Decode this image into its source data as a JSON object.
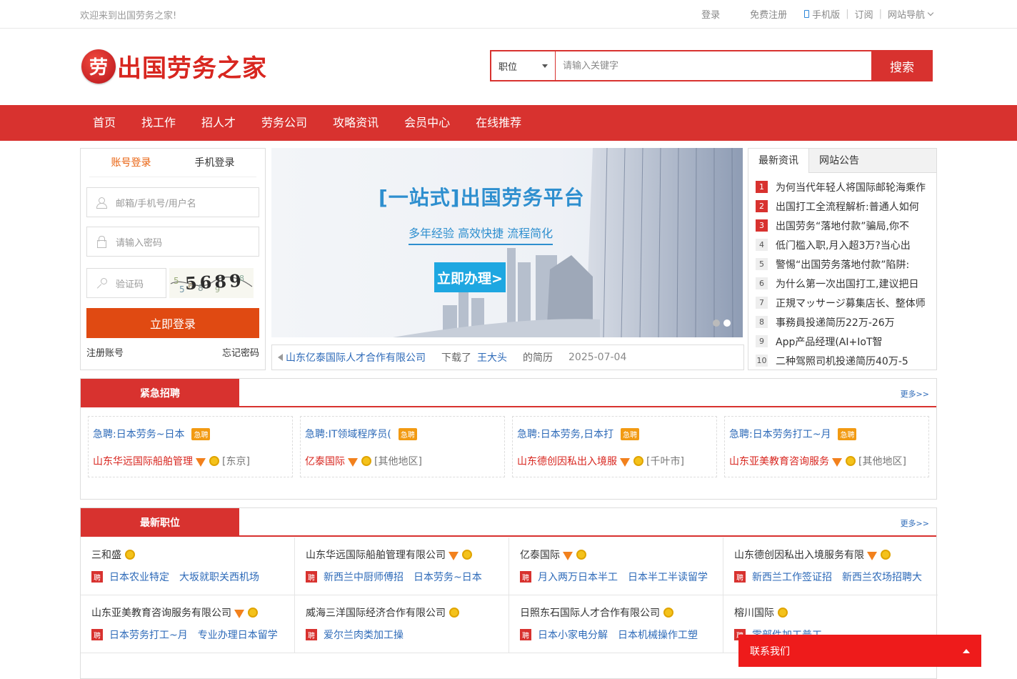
{
  "topbar": {
    "welcome": "欢迎来到出国劳务之家!",
    "login": "登录",
    "register": "免费注册",
    "mobile": "手机版",
    "subscribe": "订阅",
    "site_nav": "网站导航"
  },
  "header": {
    "logo_text": "出国劳务之家",
    "search": {
      "category": "职位",
      "placeholder": "请输入关键字",
      "button": "搜索"
    }
  },
  "nav": [
    "首页",
    "找工作",
    "招人才",
    "劳务公司",
    "攻略资讯",
    "会员中心",
    "在线推荐"
  ],
  "login": {
    "tab_account": "账号登录",
    "tab_phone": "手机登录",
    "username_placeholder": "邮箱/手机号/用户名",
    "password_placeholder": "请输入密码",
    "captcha_placeholder": "验证码",
    "captcha_text": "5689",
    "submit": "立即登录",
    "register": "注册账号",
    "forgot": "忘记密码"
  },
  "banner": {
    "title": "[一站式]出国劳务平台",
    "subtitle": "多年经验 高效快捷 流程简化",
    "cta": "立即办理>"
  },
  "notice": {
    "company": "山东亿泰国际人才合作有限公司",
    "action": "下载了",
    "person": "王大头",
    "object": "的简历",
    "date": "2025-07-04"
  },
  "news": {
    "tab_latest": "最新资讯",
    "tab_notice": "网站公告",
    "items": [
      {
        "n": "1",
        "text": "为何当代年轻人将国际邮轮海乘作"
      },
      {
        "n": "2",
        "text": "出国打工全流程解析:普通人如何"
      },
      {
        "n": "3",
        "text": "出国劳务“落地付款”骗局,你不"
      },
      {
        "n": "4",
        "text": "低门槛入职,月入超3万?当心出"
      },
      {
        "n": "5",
        "text": "警惕“出国劳务落地付款”陷阱:"
      },
      {
        "n": "6",
        "text": "为什么第一次出国打工,建议把日"
      },
      {
        "n": "7",
        "text": "正規マッサージ募集店长、整体师"
      },
      {
        "n": "8",
        "text": "事務員投递简历22万-26万"
      },
      {
        "n": "9",
        "text": "App产品经理(AI+IoT智"
      },
      {
        "n": "10",
        "text": "二种驾照司机投递简历40万-5"
      }
    ]
  },
  "urgent": {
    "title": "紧急招聘",
    "more": "更多>>",
    "tag": "急聘",
    "items": [
      {
        "job": "急聘:日本劳务~日本",
        "company": "山东华远国际船舶管理",
        "loc": "[东京]"
      },
      {
        "job": "急聘:IT领域程序员(",
        "company": "亿泰国际",
        "loc": "[其他地区]"
      },
      {
        "job": "急聘:日本劳务,日本打",
        "company": "山东德创因私出入境服",
        "loc": "[千叶市]"
      },
      {
        "job": "急聘:日本劳务打工~月",
        "company": "山东亚美教育咨询服务",
        "loc": "[其他地区]"
      }
    ]
  },
  "latest": {
    "title": "最新职位",
    "more": "更多>>",
    "pin": "聘",
    "items": [
      {
        "company": "三和盛",
        "gem": false,
        "jobs": [
          "日本农业特定",
          "大坂就职关西机场"
        ]
      },
      {
        "company": "山东华远国际船舶管理有限公司",
        "gem": true,
        "jobs": [
          "新西兰中厨师傅招",
          "日本劳务~日本"
        ]
      },
      {
        "company": "亿泰国际",
        "gem": true,
        "jobs": [
          "月入两万日本半工",
          "日本半工半读留学"
        ]
      },
      {
        "company": "山东德创因私出入境服务有限",
        "gem": true,
        "jobs": [
          "新西兰工作签证招",
          "新西兰农场招聘大"
        ]
      },
      {
        "company": "山东亚美教育咨询服务有限公司",
        "gem": true,
        "jobs": [
          "日本劳务打工~月",
          "专业办理日本留学"
        ]
      },
      {
        "company": "威海三洋国际经济合作有限公司",
        "gem": false,
        "jobs": [
          "爱尔兰肉类加工操",
          ""
        ]
      },
      {
        "company": "日照东石国际人才合作有限公司",
        "gem": false,
        "jobs": [
          "日本小家电分解",
          "日本机械操作工塑"
        ]
      },
      {
        "company": "榕川国际",
        "gem": false,
        "jobs": [
          "零部件加工普工",
          ""
        ]
      }
    ]
  },
  "contact": {
    "label": "联系我们"
  }
}
